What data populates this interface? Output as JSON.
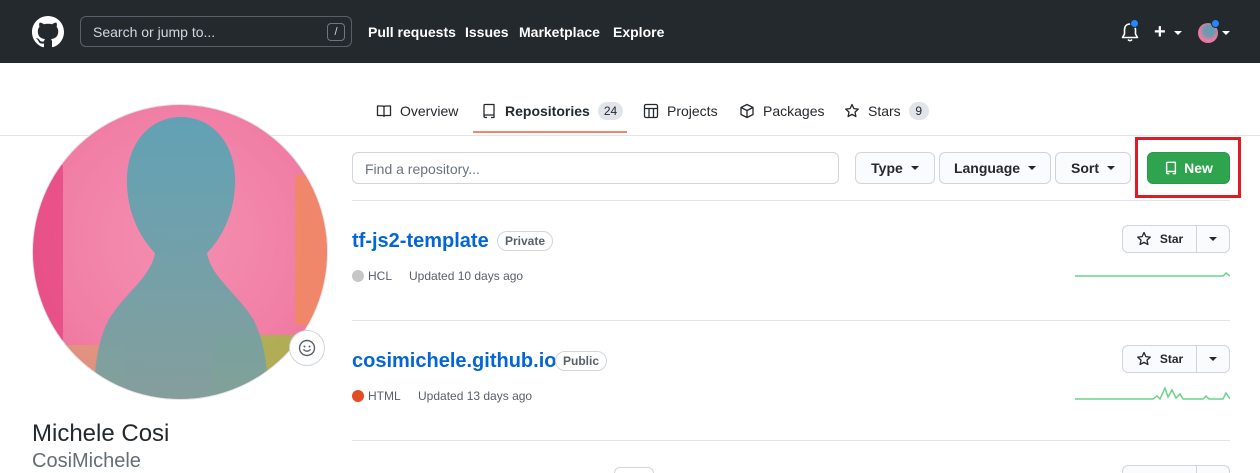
{
  "header": {
    "search_placeholder": "Search or jump to...",
    "search_key": "/",
    "nav": [
      "Pull requests",
      "Issues",
      "Marketplace",
      "Explore"
    ],
    "plus_label": "+"
  },
  "tabs": [
    {
      "label": "Overview",
      "icon": "book-icon"
    },
    {
      "label": "Repositories",
      "count": "24",
      "icon": "repo-icon",
      "active": true
    },
    {
      "label": "Projects",
      "icon": "project-icon"
    },
    {
      "label": "Packages",
      "icon": "package-icon"
    },
    {
      "label": "Stars",
      "count": "9",
      "icon": "star-icon"
    }
  ],
  "profile": {
    "name": "Michele Cosi",
    "login": "CosiMichele"
  },
  "filters": {
    "find_placeholder": "Find a repository...",
    "type_label": "Type",
    "language_label": "Language",
    "sort_label": "Sort",
    "new_label": "New"
  },
  "repos": [
    {
      "name": "tf-js2-template",
      "visibility": "Private",
      "language": "HCL",
      "language_color": "#c6c6c6",
      "updated": "Updated 10 days ago",
      "star_label": "Star"
    },
    {
      "name": "cosimichele.github.io",
      "visibility": "Public",
      "language": "HTML",
      "language_color": "#e34c26",
      "updated": "Updated 13 days ago",
      "star_label": "Star"
    }
  ],
  "colors": {
    "header_bg": "#24292e",
    "link": "#0366d6",
    "new_button": "#2ea44f",
    "highlight": "#e01b24",
    "active_tab_underline": "#f9826c"
  }
}
